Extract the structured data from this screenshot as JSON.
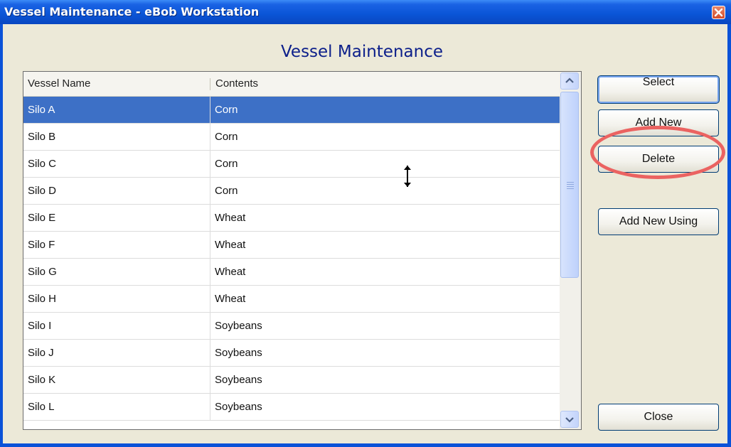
{
  "window": {
    "title": "Vessel Maintenance - eBob Workstation",
    "heading": "Vessel Maintenance"
  },
  "table": {
    "columns": [
      "Vessel Name",
      "Contents"
    ],
    "rows": [
      {
        "name": "Silo A",
        "contents": "Corn"
      },
      {
        "name": "Silo B",
        "contents": "Corn"
      },
      {
        "name": "Silo C",
        "contents": "Corn"
      },
      {
        "name": "Silo D",
        "contents": "Corn"
      },
      {
        "name": "Silo E",
        "contents": "Wheat"
      },
      {
        "name": "Silo F",
        "contents": "Wheat"
      },
      {
        "name": "Silo G",
        "contents": "Wheat"
      },
      {
        "name": "Silo H",
        "contents": "Wheat"
      },
      {
        "name": "Silo I",
        "contents": "Soybeans"
      },
      {
        "name": "Silo J",
        "contents": "Soybeans"
      },
      {
        "name": "Silo K",
        "contents": "Soybeans"
      },
      {
        "name": "Silo L",
        "contents": "Soybeans"
      }
    ],
    "selected_row": "Silo A"
  },
  "buttons": {
    "select": "Select",
    "add_new": "Add New",
    "delete": "Delete",
    "add_new_using": "Add New Using",
    "close": "Close"
  },
  "colors": {
    "title_bar": "#0a54d6",
    "selection": "#3d70c6",
    "heading_text": "#0c1f8a",
    "highlight_circle": "#eb6361"
  },
  "icons": [
    "close-icon",
    "scroll-up-icon",
    "scroll-down-icon",
    "resize-cursor-icon"
  ]
}
